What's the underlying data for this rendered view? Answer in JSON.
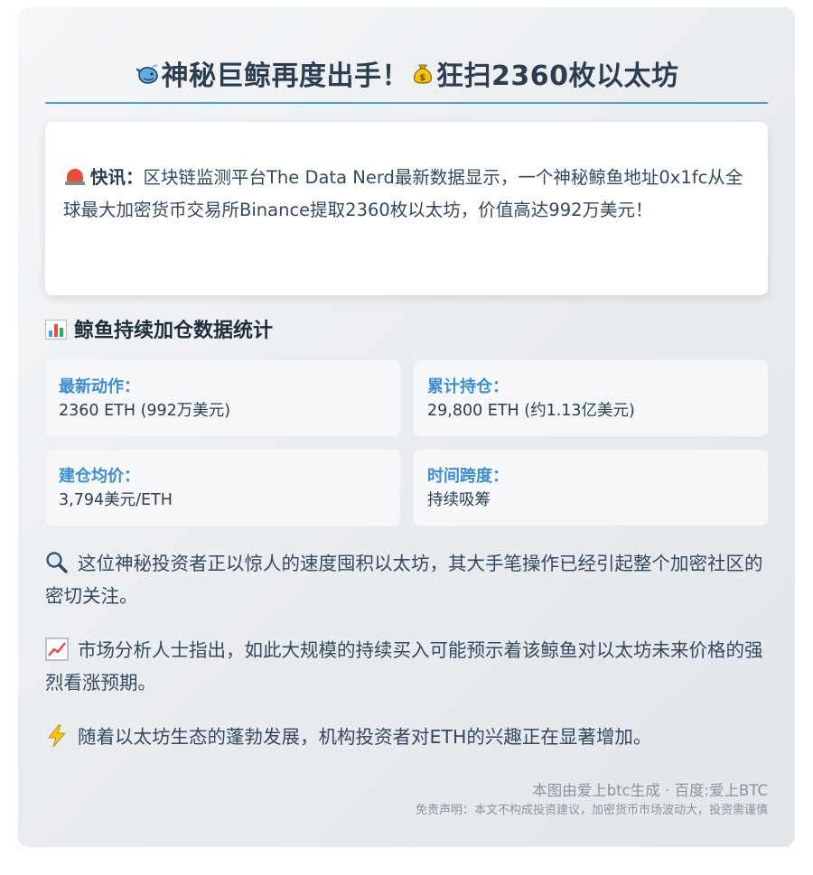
{
  "title": {
    "left_icon": "whale-icon",
    "text_part1": "神秘巨鲸再度出手！",
    "middle_icon": "money-bag-icon",
    "text_part2": "狂扫2360枚以太坊"
  },
  "alert": {
    "icon": "siren-icon",
    "label": "快讯：",
    "text": "区块链监测平台The Data Nerd最新数据显示，一个神秘鲸鱼地址0x1fc从全球最大加密货币交易所Binance提取2360枚以太坊，价值高达992万美元！"
  },
  "stats_section": {
    "icon": "bar-chart-icon",
    "title": "鲸鱼持续加仓数据统计",
    "items": [
      {
        "label": "最新动作：",
        "value": "2360 ETH (992万美元)"
      },
      {
        "label": "累计持仓：",
        "value": "29,800 ETH (约1.13亿美元)"
      },
      {
        "label": "建仓均价：",
        "value": "3,794美元/ETH"
      },
      {
        "label": "时间跨度：",
        "value": "持续吸筹"
      }
    ]
  },
  "paragraphs": [
    {
      "icon": "magnifier-icon",
      "text": "这位神秘投资者正以惊人的速度囤积以太坊，其大手笔操作已经引起整个加密社区的密切关注。"
    },
    {
      "icon": "chart-increasing-icon",
      "text": "市场分析人士指出，如此大规模的持续买入可能预示着该鲸鱼对以太坊未来价格的强烈看涨预期。"
    },
    {
      "icon": "lightning-icon",
      "text": "随着以太坊生态的蓬勃发展，机构投资者对ETH的兴趣正在显著增加。"
    }
  ],
  "footer": {
    "source": "本图由爱上btc生成 · 百度:爱上BTC",
    "disclaimer": "免责声明：本文不构成投资建议，加密货币市场波动大，投资需谨慎"
  },
  "colors": {
    "accent": "#4a9fd8",
    "label_blue": "#3d8fd1",
    "title_text": "#2c3e50",
    "alert_red": "#e74c3c"
  }
}
